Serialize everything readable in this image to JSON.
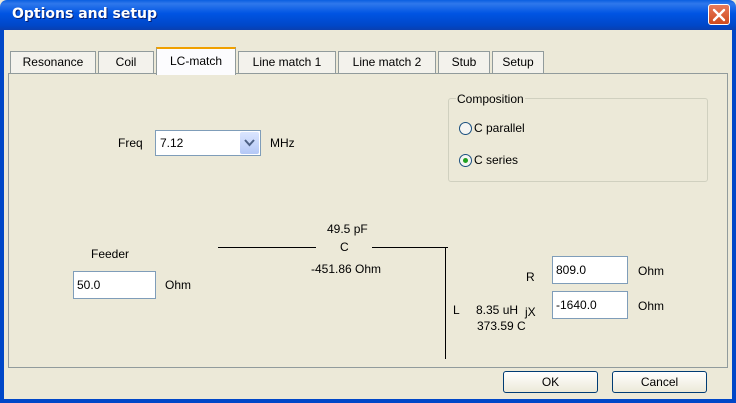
{
  "window": {
    "title": "Options and setup"
  },
  "tabs": [
    {
      "label": "Resonance"
    },
    {
      "label": "Coil"
    },
    {
      "label": "LC-match"
    },
    {
      "label": "Line match  1"
    },
    {
      "label": "Line match 2"
    },
    {
      "label": "Stub"
    },
    {
      "label": "Setup"
    }
  ],
  "active_tab": "LC-match",
  "freq": {
    "label": "Freq",
    "value": "7.12",
    "unit": "MHz"
  },
  "composition": {
    "title": "Composition",
    "options": [
      {
        "label": "C parallel",
        "checked": false
      },
      {
        "label": "C series",
        "checked": true
      }
    ]
  },
  "feeder": {
    "label": "Feeder",
    "value": "50.0",
    "unit": "Ohm"
  },
  "capacitor": {
    "value": "49.5 pF",
    "name": "C",
    "reactance": "-451.86 Ohm"
  },
  "inductor": {
    "name": "L",
    "value": "8.35 uH",
    "reactance": "373.59 C"
  },
  "load": {
    "r_label": "R",
    "r_value": "809.0",
    "r_unit": "Ohm",
    "jx_label": "jX",
    "jx_value": "-1640.0",
    "jx_unit": "Ohm"
  },
  "buttons": {
    "ok": "OK",
    "cancel": "Cancel"
  },
  "colors": {
    "titlebar": "#0054e3",
    "active_tab_highlight": "#f0a000",
    "radio_dot": "#21a121",
    "close": "#d04a1c"
  }
}
